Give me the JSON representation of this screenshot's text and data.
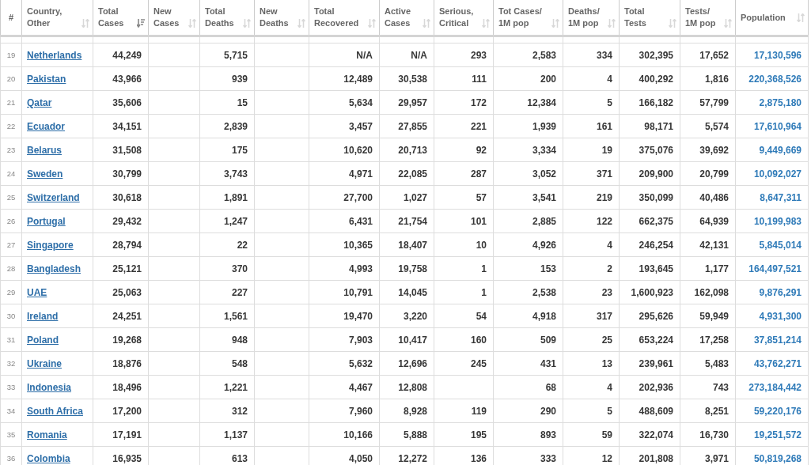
{
  "table": {
    "columns": [
      {
        "label": [
          "#"
        ]
      },
      {
        "label": [
          "Country,",
          "Other"
        ],
        "sorted": false
      },
      {
        "label": [
          "Total",
          "Cases"
        ],
        "sorted": true
      },
      {
        "label": [
          "New",
          "Cases"
        ],
        "sorted": false
      },
      {
        "label": [
          "Total",
          "Deaths"
        ],
        "sorted": false
      },
      {
        "label": [
          "New",
          "Deaths"
        ],
        "sorted": false
      },
      {
        "label": [
          "Total",
          "Recovered"
        ],
        "sorted": false
      },
      {
        "label": [
          "Active",
          "Cases"
        ],
        "sorted": false
      },
      {
        "label": [
          "Serious,",
          "Critical"
        ],
        "sorted": false
      },
      {
        "label": [
          "Tot Cases/",
          "1M pop"
        ],
        "sorted": false
      },
      {
        "label": [
          "Deaths/",
          "1M pop"
        ],
        "sorted": false
      },
      {
        "label": [
          "Total",
          "Tests"
        ],
        "sorted": false
      },
      {
        "label": [
          "Tests/",
          "1M pop"
        ],
        "sorted": false
      },
      {
        "label": [
          "Population"
        ],
        "sorted": false
      }
    ],
    "rows": [
      {
        "rank": "19",
        "country": "Netherlands",
        "total_cases": "44,249",
        "total_deaths": "5,715",
        "total_recovered": "N/A",
        "active_cases": "N/A",
        "serious_critical": "293",
        "cases_per_1m": "2,583",
        "deaths_per_1m": "334",
        "total_tests": "302,395",
        "tests_per_1m": "17,652",
        "population": "17,130,596"
      },
      {
        "rank": "20",
        "country": "Pakistan",
        "total_cases": "43,966",
        "total_deaths": "939",
        "total_recovered": "12,489",
        "active_cases": "30,538",
        "serious_critical": "111",
        "cases_per_1m": "200",
        "deaths_per_1m": "4",
        "total_tests": "400,292",
        "tests_per_1m": "1,816",
        "population": "220,368,526"
      },
      {
        "rank": "21",
        "country": "Qatar",
        "total_cases": "35,606",
        "total_deaths": "15",
        "total_recovered": "5,634",
        "active_cases": "29,957",
        "serious_critical": "172",
        "cases_per_1m": "12,384",
        "deaths_per_1m": "5",
        "total_tests": "166,182",
        "tests_per_1m": "57,799",
        "population": "2,875,180"
      },
      {
        "rank": "22",
        "country": "Ecuador",
        "total_cases": "34,151",
        "total_deaths": "2,839",
        "total_recovered": "3,457",
        "active_cases": "27,855",
        "serious_critical": "221",
        "cases_per_1m": "1,939",
        "deaths_per_1m": "161",
        "total_tests": "98,171",
        "tests_per_1m": "5,574",
        "population": "17,610,964"
      },
      {
        "rank": "23",
        "country": "Belarus",
        "total_cases": "31,508",
        "total_deaths": "175",
        "total_recovered": "10,620",
        "active_cases": "20,713",
        "serious_critical": "92",
        "cases_per_1m": "3,334",
        "deaths_per_1m": "19",
        "total_tests": "375,076",
        "tests_per_1m": "39,692",
        "population": "9,449,669"
      },
      {
        "rank": "24",
        "country": "Sweden",
        "total_cases": "30,799",
        "total_deaths": "3,743",
        "total_recovered": "4,971",
        "active_cases": "22,085",
        "serious_critical": "287",
        "cases_per_1m": "3,052",
        "deaths_per_1m": "371",
        "total_tests": "209,900",
        "tests_per_1m": "20,799",
        "population": "10,092,027"
      },
      {
        "rank": "25",
        "country": "Switzerland",
        "total_cases": "30,618",
        "total_deaths": "1,891",
        "total_recovered": "27,700",
        "active_cases": "1,027",
        "serious_critical": "57",
        "cases_per_1m": "3,541",
        "deaths_per_1m": "219",
        "total_tests": "350,099",
        "tests_per_1m": "40,486",
        "population": "8,647,311"
      },
      {
        "rank": "26",
        "country": "Portugal",
        "total_cases": "29,432",
        "total_deaths": "1,247",
        "total_recovered": "6,431",
        "active_cases": "21,754",
        "serious_critical": "101",
        "cases_per_1m": "2,885",
        "deaths_per_1m": "122",
        "total_tests": "662,375",
        "tests_per_1m": "64,939",
        "population": "10,199,983"
      },
      {
        "rank": "27",
        "country": "Singapore",
        "total_cases": "28,794",
        "total_deaths": "22",
        "total_recovered": "10,365",
        "active_cases": "18,407",
        "serious_critical": "10",
        "cases_per_1m": "4,926",
        "deaths_per_1m": "4",
        "total_tests": "246,254",
        "tests_per_1m": "42,131",
        "population": "5,845,014"
      },
      {
        "rank": "28",
        "country": "Bangladesh",
        "total_cases": "25,121",
        "total_deaths": "370",
        "total_recovered": "4,993",
        "active_cases": "19,758",
        "serious_critical": "1",
        "cases_per_1m": "153",
        "deaths_per_1m": "2",
        "total_tests": "193,645",
        "tests_per_1m": "1,177",
        "population": "164,497,521"
      },
      {
        "rank": "29",
        "country": "UAE",
        "total_cases": "25,063",
        "total_deaths": "227",
        "total_recovered": "10,791",
        "active_cases": "14,045",
        "serious_critical": "1",
        "cases_per_1m": "2,538",
        "deaths_per_1m": "23",
        "total_tests": "1,600,923",
        "tests_per_1m": "162,098",
        "population": "9,876,291"
      },
      {
        "rank": "30",
        "country": "Ireland",
        "total_cases": "24,251",
        "total_deaths": "1,561",
        "total_recovered": "19,470",
        "active_cases": "3,220",
        "serious_critical": "54",
        "cases_per_1m": "4,918",
        "deaths_per_1m": "317",
        "total_tests": "295,626",
        "tests_per_1m": "59,949",
        "population": "4,931,300"
      },
      {
        "rank": "31",
        "country": "Poland",
        "total_cases": "19,268",
        "total_deaths": "948",
        "total_recovered": "7,903",
        "active_cases": "10,417",
        "serious_critical": "160",
        "cases_per_1m": "509",
        "deaths_per_1m": "25",
        "total_tests": "653,224",
        "tests_per_1m": "17,258",
        "population": "37,851,214"
      },
      {
        "rank": "32",
        "country": "Ukraine",
        "total_cases": "18,876",
        "total_deaths": "548",
        "total_recovered": "5,632",
        "active_cases": "12,696",
        "serious_critical": "245",
        "cases_per_1m": "431",
        "deaths_per_1m": "13",
        "total_tests": "239,961",
        "tests_per_1m": "5,483",
        "population": "43,762,271"
      },
      {
        "rank": "33",
        "country": "Indonesia",
        "total_cases": "18,496",
        "total_deaths": "1,221",
        "total_recovered": "4,467",
        "active_cases": "12,808",
        "cases_per_1m": "68",
        "deaths_per_1m": "4",
        "total_tests": "202,936",
        "tests_per_1m": "743",
        "population": "273,184,442"
      },
      {
        "rank": "34",
        "country": "South Africa",
        "total_cases": "17,200",
        "total_deaths": "312",
        "total_recovered": "7,960",
        "active_cases": "8,928",
        "serious_critical": "119",
        "cases_per_1m": "290",
        "deaths_per_1m": "5",
        "total_tests": "488,609",
        "tests_per_1m": "8,251",
        "population": "59,220,176"
      },
      {
        "rank": "35",
        "country": "Romania",
        "total_cases": "17,191",
        "total_deaths": "1,137",
        "total_recovered": "10,166",
        "active_cases": "5,888",
        "serious_critical": "195",
        "cases_per_1m": "893",
        "deaths_per_1m": "59",
        "total_tests": "322,074",
        "tests_per_1m": "16,730",
        "population": "19,251,572"
      },
      {
        "rank": "36",
        "country": "Colombia",
        "total_cases": "16,935",
        "total_deaths": "613",
        "total_recovered": "4,050",
        "active_cases": "12,272",
        "serious_critical": "136",
        "cases_per_1m": "333",
        "deaths_per_1m": "12",
        "total_tests": "201,808",
        "tests_per_1m": "3,971",
        "population": "50,819,268"
      }
    ]
  }
}
